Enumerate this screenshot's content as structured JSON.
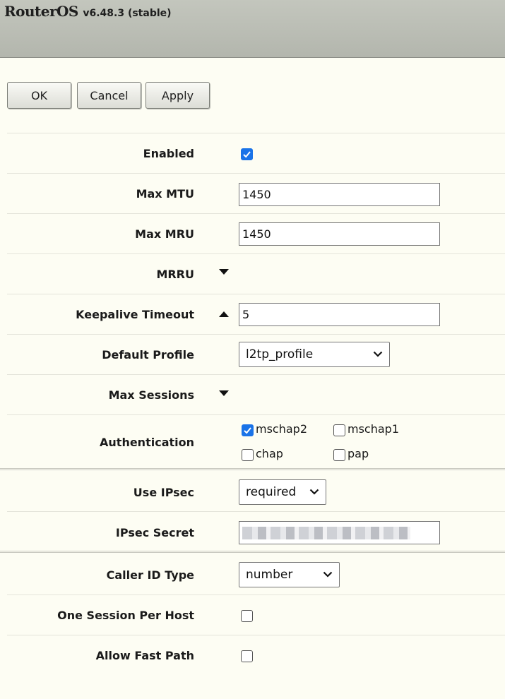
{
  "header": {
    "brand": "RouterOS",
    "version": "v6.48.3 (stable)"
  },
  "toolbar": {
    "ok_label": "OK",
    "cancel_label": "Cancel",
    "apply_label": "Apply"
  },
  "form": {
    "enabled": {
      "label": "Enabled",
      "checked": true
    },
    "max_mtu": {
      "label": "Max MTU",
      "value": "1450"
    },
    "max_mru": {
      "label": "Max MRU",
      "value": "1450"
    },
    "mrru": {
      "label": "MRRU",
      "expanded": false
    },
    "keepalive_timeout": {
      "label": "Keepalive Timeout",
      "value": "5",
      "expanded": true
    },
    "default_profile": {
      "label": "Default Profile",
      "value": "l2tp_profile"
    },
    "max_sessions": {
      "label": "Max Sessions",
      "expanded": false
    },
    "authentication": {
      "label": "Authentication",
      "options": [
        {
          "name": "mschap2",
          "checked": true
        },
        {
          "name": "mschap1",
          "checked": false
        },
        {
          "name": "chap",
          "checked": false
        },
        {
          "name": "pap",
          "checked": false
        }
      ]
    },
    "use_ipsec": {
      "label": "Use IPsec",
      "value": "required"
    },
    "ipsec_secret": {
      "label": "IPsec Secret"
    },
    "caller_id_type": {
      "label": "Caller ID Type",
      "value": "number"
    },
    "one_session_per_host": {
      "label": "One Session Per Host",
      "checked": false
    },
    "allow_fast_path": {
      "label": "Allow Fast Path",
      "checked": false
    }
  },
  "colors": {
    "page_bg": "#fdfdf3",
    "titlebar_bg": "#b9bcb3",
    "checkbox_accent": "#1a73e8"
  }
}
